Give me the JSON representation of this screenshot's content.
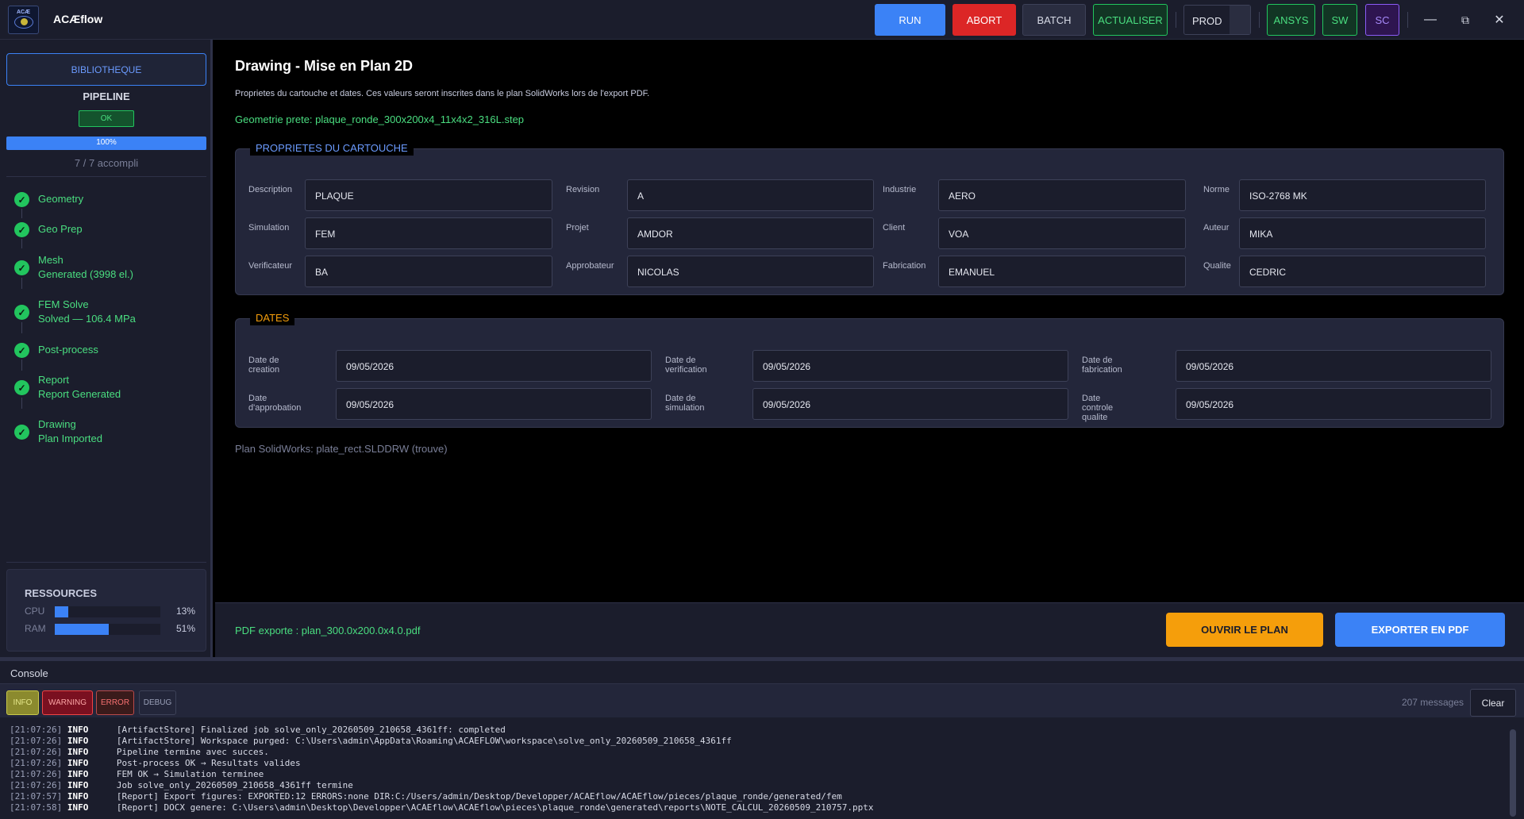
{
  "app": {
    "logo_text": "ACÆ",
    "title": "ACÆflow"
  },
  "toolbar": {
    "run": "RUN",
    "abort": "ABORT",
    "batch": "BATCH",
    "actualiser": "ACTUALISER",
    "profile": "PROD",
    "ansys": "ANSYS",
    "sw": "SW",
    "sc": "SC",
    "minimize_icon": "—",
    "restore_icon": "⧉",
    "close_icon": "✕"
  },
  "sidebar": {
    "library_button": "BIBLIOTHEQUE",
    "pipeline_title": "PIPELINE",
    "status_badge": "OK",
    "progress_fraction": 1.0,
    "progress_label": "100%",
    "accomplished": "7 / 7 accompli",
    "steps": [
      {
        "label": "Geometry",
        "detail": ""
      },
      {
        "label": "Geo Prep",
        "detail": ""
      },
      {
        "label": "Mesh",
        "detail": "Generated (3998 el.)"
      },
      {
        "label": "FEM Solve",
        "detail": "Solved — 106.4 MPa"
      },
      {
        "label": "Post-process",
        "detail": ""
      },
      {
        "label": "Report",
        "detail": "Report Generated"
      },
      {
        "label": "Drawing",
        "detail": "Plan Imported"
      }
    ],
    "resources": {
      "title": "RESSOURCES",
      "cpu": {
        "label": "CPU",
        "value": "13%",
        "fraction": 0.13
      },
      "ram": {
        "label": "RAM",
        "value": "51%",
        "fraction": 0.51
      }
    }
  },
  "main": {
    "title": "Drawing - Mise en Plan 2D",
    "subtitle": "Proprietes du cartouche et dates. Ces valeurs seront inscrites dans le plan SolidWorks lors de l'export PDF.",
    "geometry_status": "Geometrie prete: plaque_ronde_300x200x4_11x4x2_316L.step",
    "cartouche": {
      "title": "PROPRIETES DU CARTOUCHE",
      "fields": [
        {
          "label": "Description",
          "value": "PLAQUE"
        },
        {
          "label": "Revision",
          "value": "A"
        },
        {
          "label": "Industrie",
          "value": "AERO"
        },
        {
          "label": "Norme",
          "value": "ISO-2768 MK"
        },
        {
          "label": "Simulation",
          "value": "FEM"
        },
        {
          "label": "Projet",
          "value": "AMDOR"
        },
        {
          "label": "Client",
          "value": "VOA"
        },
        {
          "label": "Auteur",
          "value": "MIKA"
        },
        {
          "label": "Verificateur",
          "value": "BA"
        },
        {
          "label": "Approbateur",
          "value": "NICOLAS"
        },
        {
          "label": "Fabrication",
          "value": "EMANUEL"
        },
        {
          "label": "Qualite",
          "value": "CEDRIC"
        }
      ]
    },
    "dates": {
      "title": "DATES",
      "fields": [
        {
          "label": "Date de creation",
          "value": "09/05/2026"
        },
        {
          "label": "Date de verification",
          "value": "09/05/2026"
        },
        {
          "label": "Date de fabrication",
          "value": "09/05/2026"
        },
        {
          "label": "Date d'approbation",
          "value": "09/05/2026"
        },
        {
          "label": "Date de simulation",
          "value": "09/05/2026"
        },
        {
          "label": "Date controle qualite",
          "value": "09/05/2026"
        }
      ]
    },
    "plan_info": "Plan SolidWorks: plate_rect.SLDDRW (trouve)",
    "footer": {
      "pdf_status": "PDF exporte : plan_300.0x200.0x4.0.pdf",
      "open_button": "OUVRIR LE PLAN",
      "export_button": "EXPORTER EN PDF"
    }
  },
  "console": {
    "title": "Console",
    "filters": {
      "info": "INFO",
      "warning": "WARNING",
      "error": "ERROR",
      "debug": "DEBUG"
    },
    "message_count": "207 messages",
    "clear": "Clear",
    "lines": [
      {
        "ts": "[21:07:26]",
        "level": "INFO",
        "msg": "[ArtifactStore] Finalized job solve_only_20260509_210658_4361ff: completed"
      },
      {
        "ts": "[21:07:26]",
        "level": "INFO",
        "msg": "[ArtifactStore] Workspace purged: C:\\Users\\admin\\AppData\\Roaming\\ACAEFLOW\\workspace\\solve_only_20260509_210658_4361ff"
      },
      {
        "ts": "[21:07:26]",
        "level": "INFO",
        "msg": "Pipeline termine avec succes."
      },
      {
        "ts": "[21:07:26]",
        "level": "INFO",
        "msg": "Post-process OK → Resultats valides"
      },
      {
        "ts": "[21:07:26]",
        "level": "INFO",
        "msg": "FEM OK → Simulation terminee"
      },
      {
        "ts": "[21:07:26]",
        "level": "INFO",
        "msg": "Job solve_only_20260509_210658_4361ff termine"
      },
      {
        "ts": "[21:07:57]",
        "level": "INFO",
        "msg": "[Report] Export figures: EXPORTED:12 ERRORS:none DIR:C:/Users/admin/Desktop/Developper/ACAEflow/ACAEflow/pieces/plaque_ronde/generated/fem"
      },
      {
        "ts": "[21:07:58]",
        "level": "INFO",
        "msg": "[Report] DOCX genere: C:\\Users\\admin\\Desktop\\Developper\\ACAEflow\\ACAEflow\\pieces\\plaque_ronde\\generated\\reports\\NOTE_CALCUL_20260509_210757.pptx"
      }
    ]
  },
  "colors": {
    "accent": "#3b82f6",
    "success": "#22c55e",
    "danger": "#dc2626",
    "warning": "#f59e0b",
    "purple": "#8b5cf6",
    "panel": "#1b1d2c",
    "card": "#23263a"
  }
}
